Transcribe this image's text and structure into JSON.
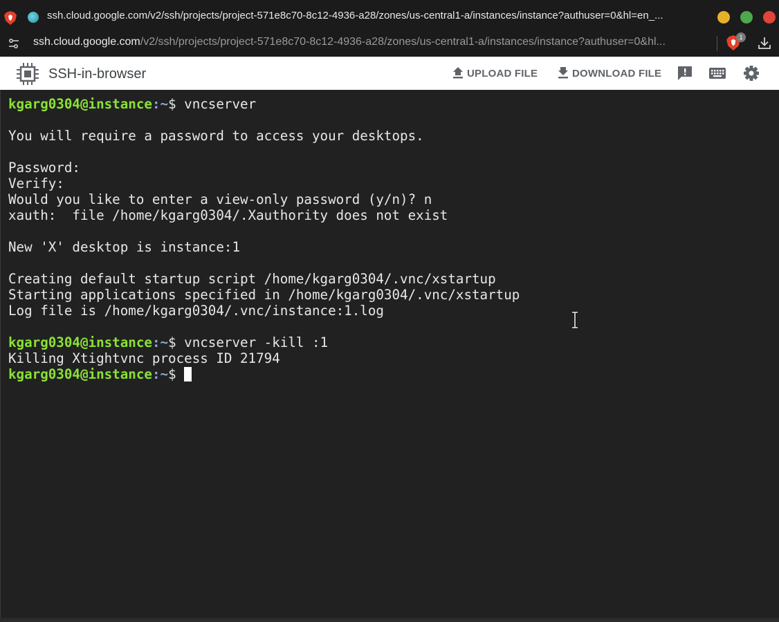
{
  "browser": {
    "tab_title": "ssh.cloud.google.com/v2/ssh/projects/project-571e8c70-8c12-4936-a28/zones/us-central1-a/instances/instance?authuser=0&hl=en_...",
    "url_host": "ssh.cloud.google.com",
    "url_path": "/v2/ssh/projects/project-571e8c70-8c12-4936-a28/zones/us-central1-a/instances/instance?authuser=0&hl...",
    "shield_badge": "1",
    "colors": {
      "chrome_bg": "#1b1b1b",
      "min": "#e6b12a",
      "max": "#4ca84c",
      "close": "#e0443a"
    }
  },
  "appbar": {
    "title": "SSH-in-browser",
    "upload_label": "UPLOAD FILE",
    "download_label": "DOWNLOAD FILE",
    "icons": [
      "chip-icon",
      "upload-icon",
      "download-icon",
      "feedback-icon",
      "keyboard-icon",
      "settings-icon"
    ]
  },
  "terminal": {
    "prompt_user": "kgarg0304@instance",
    "prompt_path": ":~",
    "prompt_symbol": "$ ",
    "lines": [
      {
        "type": "prompt",
        "command": "vncserver"
      },
      {
        "type": "text",
        "text": ""
      },
      {
        "type": "text",
        "text": "You will require a password to access your desktops."
      },
      {
        "type": "text",
        "text": ""
      },
      {
        "type": "text",
        "text": "Password:"
      },
      {
        "type": "text",
        "text": "Verify:"
      },
      {
        "type": "text",
        "text": "Would you like to enter a view-only password (y/n)? n"
      },
      {
        "type": "text",
        "text": "xauth:  file /home/kgarg0304/.Xauthority does not exist"
      },
      {
        "type": "text",
        "text": ""
      },
      {
        "type": "text",
        "text": "New 'X' desktop is instance:1"
      },
      {
        "type": "text",
        "text": ""
      },
      {
        "type": "text",
        "text": "Creating default startup script /home/kgarg0304/.vnc/xstartup"
      },
      {
        "type": "text",
        "text": "Starting applications specified in /home/kgarg0304/.vnc/xstartup"
      },
      {
        "type": "text",
        "text": "Log file is /home/kgarg0304/.vnc/instance:1.log"
      },
      {
        "type": "text",
        "text": ""
      },
      {
        "type": "prompt",
        "command": "vncserver -kill :1"
      },
      {
        "type": "text",
        "text": "Killing Xtightvnc process ID 21794"
      },
      {
        "type": "prompt",
        "command": "",
        "cursor": true
      }
    ],
    "colors": {
      "bg": "#212121",
      "fg": "#e8e8e8",
      "user": "#8ae234",
      "path": "#8fa8d8"
    }
  }
}
